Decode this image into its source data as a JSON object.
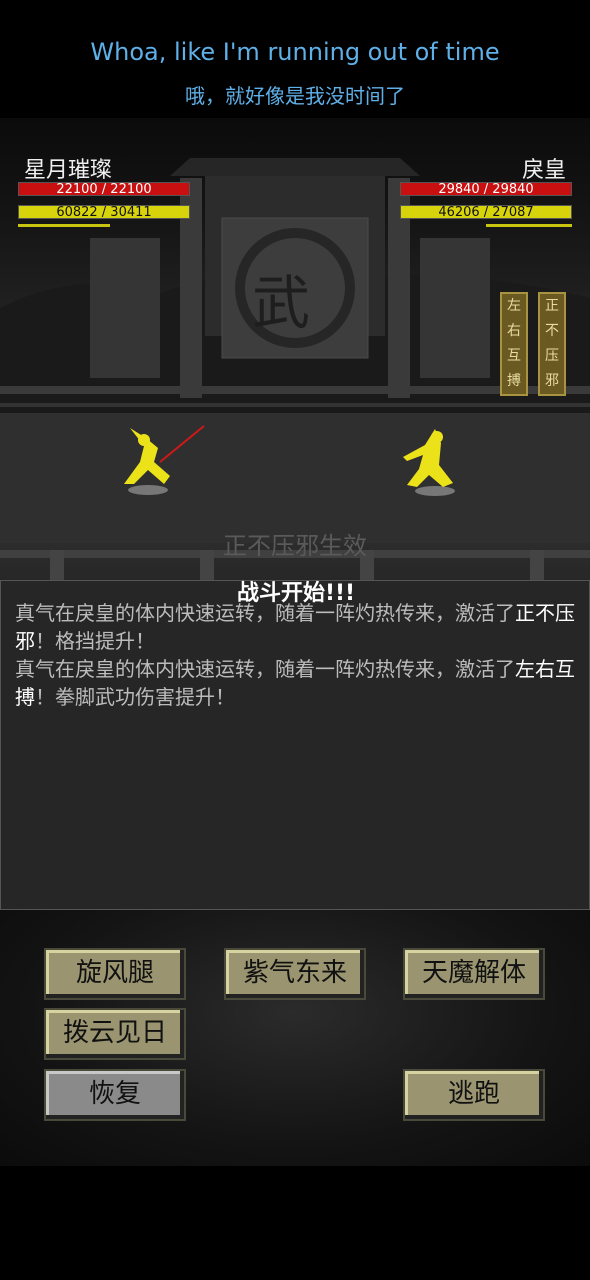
{
  "subtitles": {
    "english": "Whoa, like I'm running out of time",
    "chinese": "哦，就好像是我没时间了"
  },
  "player": {
    "name": "星月璀璨",
    "hp": "22100 / 22100",
    "hp_fraction": 1.0,
    "qi": "60822 / 30411",
    "qi_fraction": 1.0
  },
  "enemy": {
    "name": "戾皇",
    "hp": "29840 / 29840",
    "hp_fraction": 1.0,
    "qi": "46206 / 27087",
    "qi_fraction": 1.0,
    "buffs": [
      "左右互搏",
      "正不压邪"
    ]
  },
  "scene": {
    "banner_glyph": "武",
    "effect_text": "正不压邪生效"
  },
  "log": {
    "title": "战斗开始!!!",
    "lines": [
      {
        "pre": "真气在戾皇的体内快速运转，随着一阵灼热传来，激活了",
        "highlight": "正不压邪",
        "post": "！格挡提升！"
      },
      {
        "pre": "真气在戾皇的体内快速运转，随着一阵灼热传来，激活了",
        "highlight": "左右互搏",
        "post": "！拳脚武功伤害提升！"
      }
    ]
  },
  "skills": {
    "xuanfengtui": "旋风腿",
    "ziqidonglai": "紫气东来",
    "tianmojieti": "天魔解体",
    "bayunjianri": "拨云见日",
    "huifu": "恢复",
    "taopao": "逃跑"
  }
}
